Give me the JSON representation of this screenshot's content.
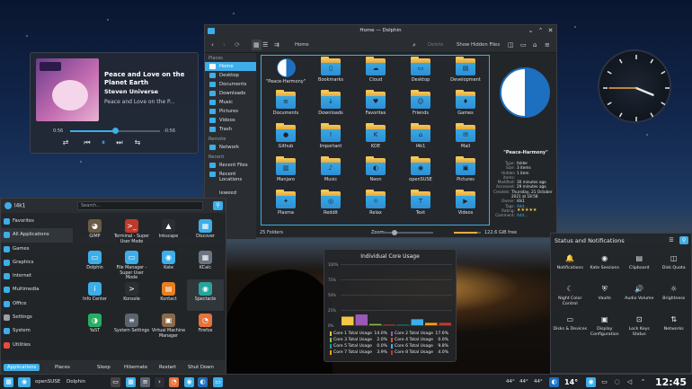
{
  "media": {
    "title": "Peace and Love on the Planet Earth",
    "artist": "Steven Universe",
    "album": "Peace and Love on the P...",
    "elapsed": "0:56",
    "remaining": "-0:56",
    "progress": 0.5,
    "controls": [
      "shuffle-icon",
      "previous-icon",
      "play-pause-icon",
      "next-icon",
      "repeat-icon"
    ]
  },
  "dolphin": {
    "title": "Home — Dolphin",
    "breadcrumb": "Home",
    "toolbar": {
      "delete": "Delete",
      "show_hidden": "Show Hidden Files"
    },
    "places": {
      "head": "Places",
      "items": [
        "Home",
        "Desktop",
        "Documents",
        "Downloads",
        "Music",
        "Pictures",
        "Videos",
        "Trash"
      ],
      "remote_head": "Remote",
      "remote": [
        "Network"
      ],
      "recent_head": "Recent",
      "recent": [
        "Recent Files",
        "Recent Locations"
      ],
      "partial": "leweed"
    },
    "files": [
      {
        "name": "\"Peace-Harmony\"",
        "kind": "peace"
      },
      {
        "name": "Bookmarks",
        "glyph": "▯"
      },
      {
        "name": "Cloud",
        "glyph": "☁"
      },
      {
        "name": "Desktop",
        "glyph": "▭"
      },
      {
        "name": "Development",
        "glyph": "▤"
      },
      {
        "name": "Documents",
        "glyph": "≡"
      },
      {
        "name": "Downloads",
        "glyph": "↓"
      },
      {
        "name": "Favorites",
        "glyph": "♥"
      },
      {
        "name": "Friends",
        "glyph": "☺"
      },
      {
        "name": "Games",
        "glyph": "♦"
      },
      {
        "name": "Github",
        "glyph": "●"
      },
      {
        "name": "Important",
        "glyph": "!"
      },
      {
        "name": "KDE",
        "glyph": "K"
      },
      {
        "name": "l4k1",
        "glyph": "⌂"
      },
      {
        "name": "Mail",
        "glyph": "✉"
      },
      {
        "name": "Manjaro",
        "glyph": "▥"
      },
      {
        "name": "Music",
        "glyph": "♪"
      },
      {
        "name": "Neon",
        "glyph": "◐"
      },
      {
        "name": "openSUSE",
        "glyph": "◉"
      },
      {
        "name": "Pictures",
        "glyph": "▣"
      },
      {
        "name": "Plasma",
        "glyph": "✦"
      },
      {
        "name": "Reddit",
        "glyph": "◎"
      },
      {
        "name": "Relax",
        "glyph": "☼"
      },
      {
        "name": "Text",
        "glyph": "T"
      },
      {
        "name": "Videos",
        "glyph": "▶"
      }
    ],
    "info": {
      "name": "\"Peace-Harmony\"",
      "rows": [
        {
          "k": "Type:",
          "v": "folder"
        },
        {
          "k": "Size:",
          "v": "3 items"
        },
        {
          "k": "Hidden items:",
          "v": "1 item"
        },
        {
          "k": "Modified:",
          "v": "30 minutes ago"
        },
        {
          "k": "Accessed:",
          "v": "29 minutes ago"
        },
        {
          "k": "Created:",
          "v": "Thursday, 21 October 2021 at 18:58"
        },
        {
          "k": "Owner:",
          "v": "l4k1"
        },
        {
          "k": "Tags:",
          "v": "Add..."
        },
        {
          "k": "Rating:",
          "v": "★★★★★"
        },
        {
          "k": "Comment:",
          "v": "Add..."
        }
      ]
    },
    "status": {
      "folders": "25 Folders",
      "zoom_label": "Zoom:",
      "free": "122.6 GiB free",
      "free_fraction": 0.85
    }
  },
  "clock": {
    "hour": 3,
    "minute": 45
  },
  "launcher": {
    "user": "l4k1",
    "search_placeholder": "Search...",
    "categories": [
      {
        "label": "Favorites",
        "color": "#3daee9"
      },
      {
        "label": "All Applications",
        "color": "#3daee9"
      },
      {
        "label": "Games",
        "color": "#3daee9"
      },
      {
        "label": "Graphics",
        "color": "#3daee9"
      },
      {
        "label": "Internet",
        "color": "#3daee9"
      },
      {
        "label": "Multimedia",
        "color": "#3daee9"
      },
      {
        "label": "Office",
        "color": "#3daee9"
      },
      {
        "label": "Settings",
        "color": "#9aa0a6"
      },
      {
        "label": "System",
        "color": "#3daee9"
      },
      {
        "label": "Utilities",
        "color": "#e74c3c"
      }
    ],
    "apps": [
      {
        "name": "GIMP",
        "color": "#6b5b45",
        "glyph": "◕"
      },
      {
        "name": "Terminal - Super User Mode",
        "color": "#c0392b",
        "glyph": ">_"
      },
      {
        "name": "Inkscape",
        "color": "#2b2f33",
        "glyph": "▲"
      },
      {
        "name": "Discover",
        "color": "#3daee9",
        "glyph": "▦"
      },
      {
        "name": "Dolphin",
        "color": "#3daee9",
        "glyph": "▭"
      },
      {
        "name": "File Manager - Super User Mode",
        "color": "#3daee9",
        "glyph": "▭"
      },
      {
        "name": "Kate",
        "color": "#3daee9",
        "glyph": "◉"
      },
      {
        "name": "KCalc",
        "color": "#6a7580",
        "glyph": "▦"
      },
      {
        "name": "Info Center",
        "color": "#3daee9",
        "glyph": "i"
      },
      {
        "name": "Konsole",
        "color": "#2b2f33",
        "glyph": ">"
      },
      {
        "name": "Kontact",
        "color": "#e67e22",
        "glyph": "▤"
      },
      {
        "name": "Spectacle",
        "color": "#26a69a",
        "glyph": "◉"
      },
      {
        "name": "YaST",
        "color": "#27ae60",
        "glyph": "◑"
      },
      {
        "name": "System Settings",
        "color": "#5a6470",
        "glyph": "≡"
      },
      {
        "name": "Virtual Machine Manager",
        "color": "#8a6a4a",
        "glyph": "▣"
      },
      {
        "name": "Firefox",
        "color": "#e8733a",
        "glyph": "◔"
      }
    ],
    "footer": [
      "Applications",
      "Places",
      "Sleep",
      "Hibernate",
      "Restart",
      "Shut Down"
    ]
  },
  "cores": {
    "title": "Individual Core Usage",
    "y_ticks": [
      "100%",
      "75%",
      "50%",
      "25%",
      "0%"
    ],
    "legend": [
      {
        "name": "Core 1 Total Usage",
        "value": "14.0%",
        "color": "#f6c543"
      },
      {
        "name": "Core 2 Total Usage",
        "value": "17.6%",
        "color": "#9b59b6"
      },
      {
        "name": "Core 3 Total Usage",
        "value": "2.0%",
        "color": "#8bc34a"
      },
      {
        "name": "Core 4 Total Usage",
        "value": "0.0%",
        "color": "#e74c3c"
      },
      {
        "name": "Core 5 Total Usage",
        "value": "0.0%",
        "color": "#16a085"
      },
      {
        "name": "Core 6 Total Usage",
        "value": "9.8%",
        "color": "#3daee9"
      },
      {
        "name": "Core 7 Total Usage",
        "value": "3.9%",
        "color": "#f39c12"
      },
      {
        "name": "Core 8 Total Usage",
        "value": "4.0%",
        "color": "#c0392b"
      }
    ]
  },
  "notifications": {
    "title": "Status and Notifications",
    "items": [
      {
        "label": "Notifications",
        "icon": "bell-icon",
        "glyph": "🔔"
      },
      {
        "label": "Kate Sessions",
        "icon": "kate-icon",
        "glyph": "◉"
      },
      {
        "label": "Clipboard",
        "icon": "clipboard-icon",
        "glyph": "▤"
      },
      {
        "label": "Disk Quota",
        "icon": "disk-icon",
        "glyph": "◫"
      },
      {
        "label": "Night Color Control",
        "icon": "night-icon",
        "glyph": "☾"
      },
      {
        "label": "Vaults",
        "icon": "vault-icon",
        "glyph": "⛨"
      },
      {
        "label": "Audio Volume",
        "icon": "volume-icon",
        "glyph": "🔊"
      },
      {
        "label": "Brightness",
        "icon": "brightness-icon",
        "glyph": "☼"
      },
      {
        "label": "Disks & Devices",
        "icon": "disks-icon",
        "glyph": "▭"
      },
      {
        "label": "Display Configuration",
        "icon": "display-icon",
        "glyph": "▣"
      },
      {
        "label": "Lock Keys Status",
        "icon": "lock-icon",
        "glyph": "⊡"
      },
      {
        "label": "Networks",
        "icon": "network-icon",
        "glyph": "⇅"
      }
    ]
  },
  "taskbar": {
    "tasks": [
      "openSUSE",
      "Dolphin"
    ],
    "tray": [
      "44°",
      "44°",
      "44°"
    ],
    "weather": "14°",
    "time": "12:45"
  }
}
